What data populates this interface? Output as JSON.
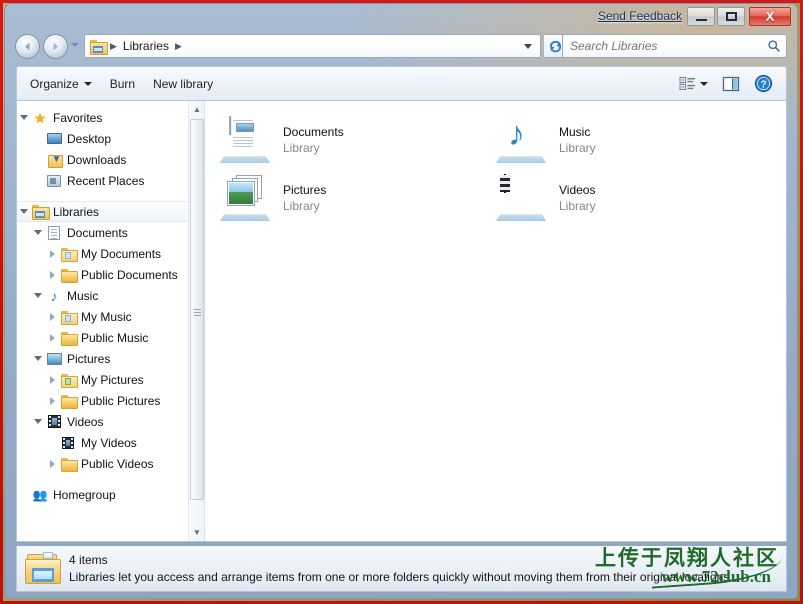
{
  "titlebar": {
    "send_feedback": "Send Feedback",
    "minimize_label": "Minimize",
    "maximize_label": "Maximize",
    "close_label": "X"
  },
  "address": {
    "back_label": "←",
    "forward_label": "→",
    "crumb_icon": "libraries-folder-icon",
    "crumbs": [
      "Libraries"
    ],
    "separator": "▶",
    "refresh_icon": "refresh-icon"
  },
  "search": {
    "placeholder": "Search Libraries",
    "value": "",
    "icon": "search-icon"
  },
  "toolbar": {
    "items": [
      {
        "label": "Organize",
        "has_caret": true
      },
      {
        "label": "Burn",
        "has_caret": false
      },
      {
        "label": "New library",
        "has_caret": false
      }
    ],
    "view_icon": "view-mode-icon",
    "view_caret": "▼",
    "preview_pane_icon": "preview-pane-icon",
    "help_icon": "help-icon",
    "help_glyph": "?"
  },
  "navpane": {
    "items": [
      {
        "label": "Favorites",
        "icon": "star-icon",
        "indent": 0,
        "twisty": "open",
        "selected": false
      },
      {
        "label": "Desktop",
        "icon": "desktop-icon",
        "indent": 1,
        "twisty": "none",
        "selected": false
      },
      {
        "label": "Downloads",
        "icon": "downloads-icon",
        "indent": 1,
        "twisty": "none",
        "selected": false
      },
      {
        "label": "Recent Places",
        "icon": "recent-places-icon",
        "indent": 1,
        "twisty": "none",
        "selected": false
      },
      {
        "label": "Libraries",
        "icon": "libraries-icon",
        "indent": 0,
        "twisty": "open",
        "selected": true
      },
      {
        "label": "Documents",
        "icon": "document-icon",
        "indent": 1,
        "twisty": "open",
        "selected": false
      },
      {
        "label": "My Documents",
        "icon": "my-documents-icon",
        "indent": 2,
        "twisty": "closed",
        "selected": false
      },
      {
        "label": "Public Documents",
        "icon": "folder-icon",
        "indent": 2,
        "twisty": "closed",
        "selected": false
      },
      {
        "label": "Music",
        "icon": "music-note-icon",
        "indent": 1,
        "twisty": "open",
        "selected": false
      },
      {
        "label": "My Music",
        "icon": "my-music-icon",
        "indent": 2,
        "twisty": "closed",
        "selected": false
      },
      {
        "label": "Public Music",
        "icon": "folder-icon",
        "indent": 2,
        "twisty": "closed",
        "selected": false
      },
      {
        "label": "Pictures",
        "icon": "pictures-icon",
        "indent": 1,
        "twisty": "open",
        "selected": false
      },
      {
        "label": "My Pictures",
        "icon": "my-pictures-icon",
        "indent": 2,
        "twisty": "closed",
        "selected": false
      },
      {
        "label": "Public Pictures",
        "icon": "folder-icon",
        "indent": 2,
        "twisty": "closed",
        "selected": false
      },
      {
        "label": "Videos",
        "icon": "videos-icon",
        "indent": 1,
        "twisty": "open",
        "selected": false
      },
      {
        "label": "My Videos",
        "icon": "my-videos-icon",
        "indent": 2,
        "twisty": "none",
        "selected": false
      },
      {
        "label": "Public Videos",
        "icon": "folder-icon",
        "indent": 2,
        "twisty": "closed",
        "selected": false
      },
      {
        "label": "Homegroup",
        "icon": "homegroup-icon",
        "indent": 0,
        "twisty": "none",
        "selected": false,
        "gap_before": true
      }
    ],
    "scroll_up": "▲",
    "scroll_down": "▼"
  },
  "files": {
    "tiles": [
      {
        "name": "Documents",
        "subtitle": "Library",
        "icon": "documents-library-icon"
      },
      {
        "name": "Music",
        "subtitle": "Library",
        "icon": "music-library-icon"
      },
      {
        "name": "Pictures",
        "subtitle": "Library",
        "icon": "pictures-library-icon"
      },
      {
        "name": "Videos",
        "subtitle": "Library",
        "icon": "videos-library-icon"
      }
    ]
  },
  "status": {
    "icon": "libraries-folder-icon",
    "count": "4 items",
    "description": "Libraries let you access and arrange items from one or more folders quickly without moving them from their original locations."
  },
  "watermark": {
    "chinese": "上传于凤翔人社区",
    "url": "www.72club.cn"
  },
  "colors": {
    "frame_red": "#c2100e",
    "inner_olive": "#b59a4a",
    "glass_blue": "#9db2cb",
    "watermark_green": "#1f6b2a",
    "close_red": "#d23b2c"
  }
}
